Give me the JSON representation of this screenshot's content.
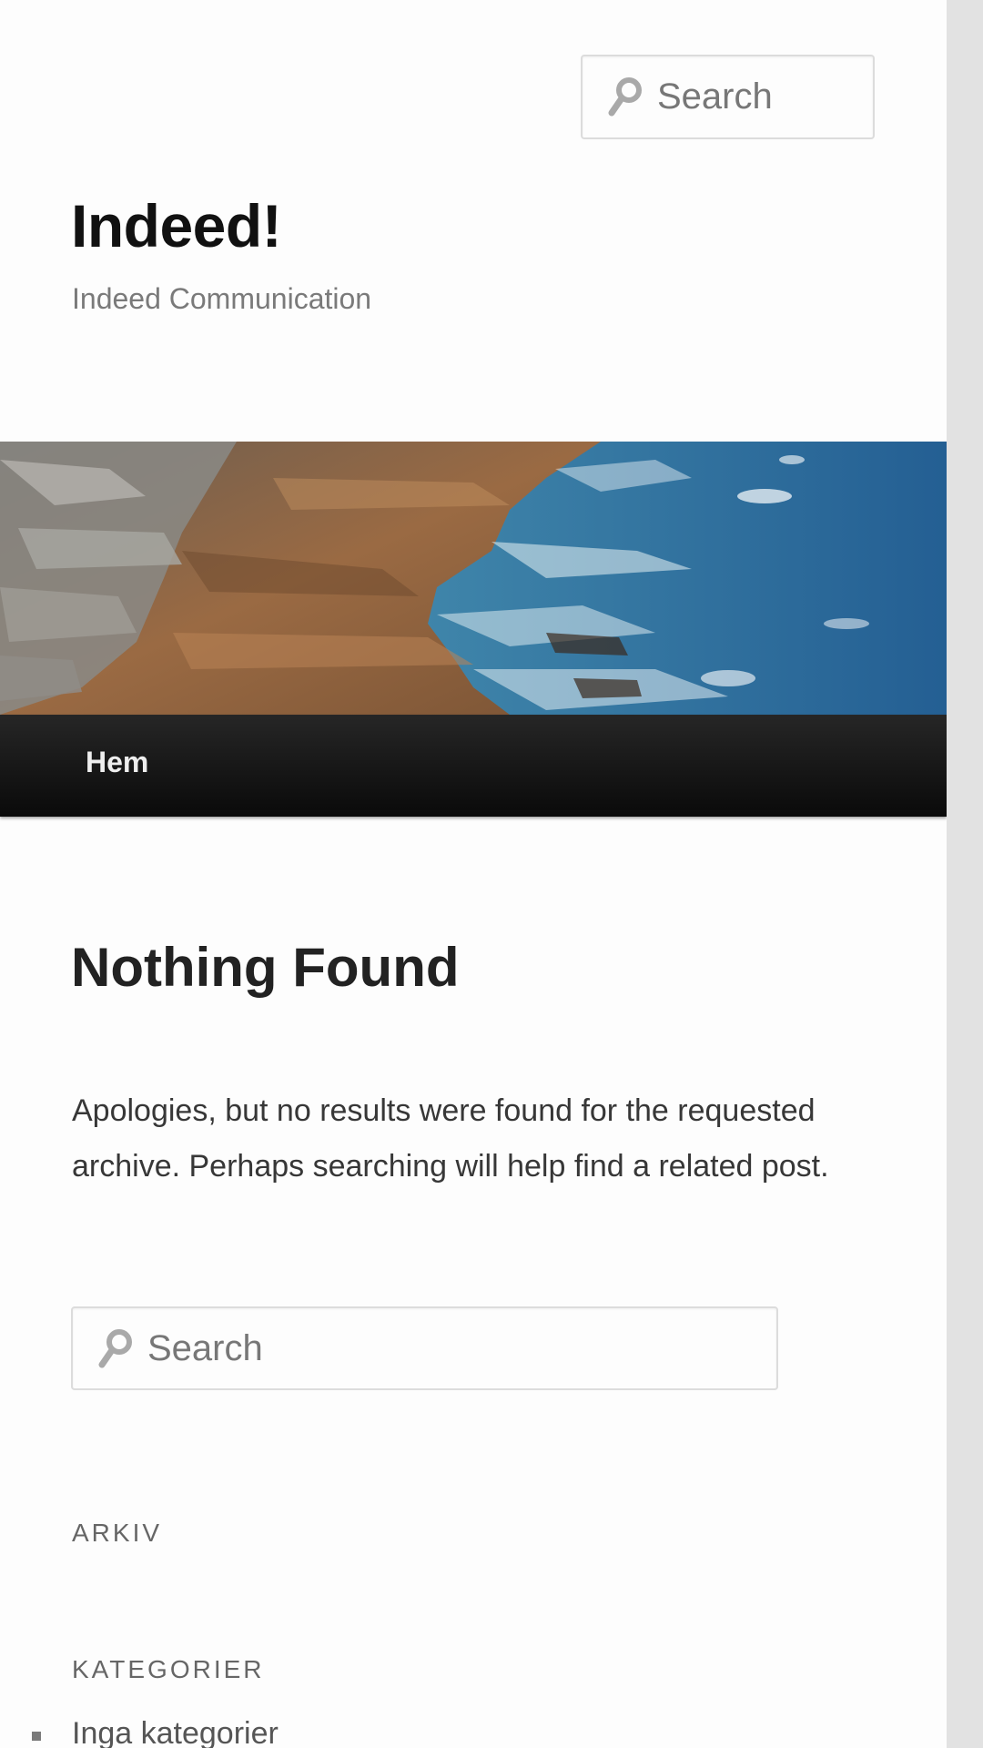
{
  "header": {
    "search_placeholder": "Search",
    "site_title": "Indeed!",
    "site_description": "Indeed Communication"
  },
  "nav": {
    "home_label": "Hem"
  },
  "main": {
    "title": "Nothing Found",
    "message": "Apologies, but no results were found for the requested archive. Perhaps searching will help find a related post.",
    "search_placeholder": "Search"
  },
  "widgets": {
    "archive_title": "ARKIV",
    "categories_title": "KATEGORIER",
    "categories": [
      {
        "label": "Inga kategorier"
      }
    ]
  },
  "colors": {
    "nav_background": "#1a1a1a",
    "page_background": "#fdfdfd",
    "sidebar_background": "#e2e2e2"
  }
}
